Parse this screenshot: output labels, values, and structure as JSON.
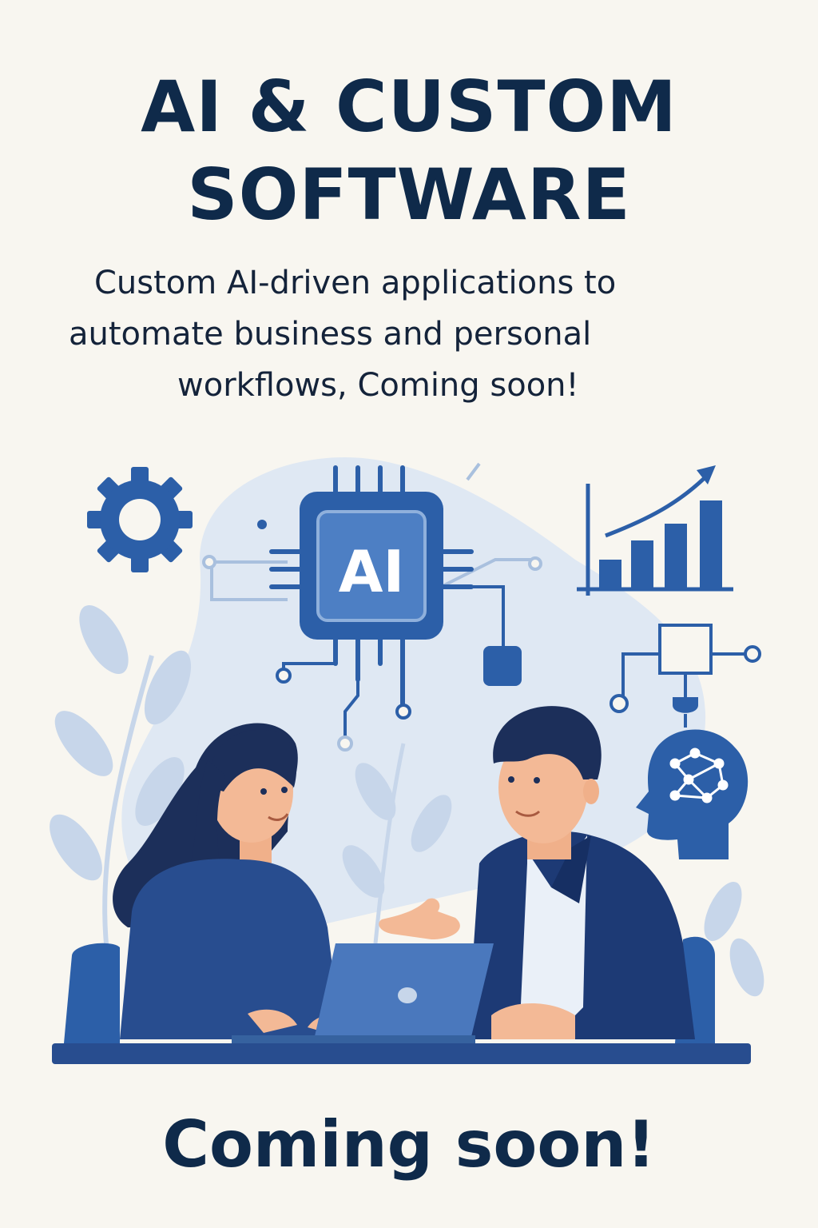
{
  "header": {
    "title_line1": "AI & CUSTOM",
    "title_line2": "SOFTWARE"
  },
  "description": {
    "line1": "Custom AI-driven applications to",
    "line2": "automate business and personal",
    "line3": "workflows, Coming soon!"
  },
  "illustration": {
    "chip_label": "AI",
    "icons": [
      "gear-icon",
      "ai-chip-icon",
      "bar-chart-growth-icon",
      "flowchart-icon",
      "brain-head-icon",
      "laptop-icon"
    ]
  },
  "footer": {
    "tagline": "Coming soon!"
  },
  "colors": {
    "background": "#f8f6f0",
    "title": "#0f2a4a",
    "primary_blue": "#2c5fa8",
    "navy": "#1f3f7a",
    "light_blue": "#dbe6f3"
  }
}
